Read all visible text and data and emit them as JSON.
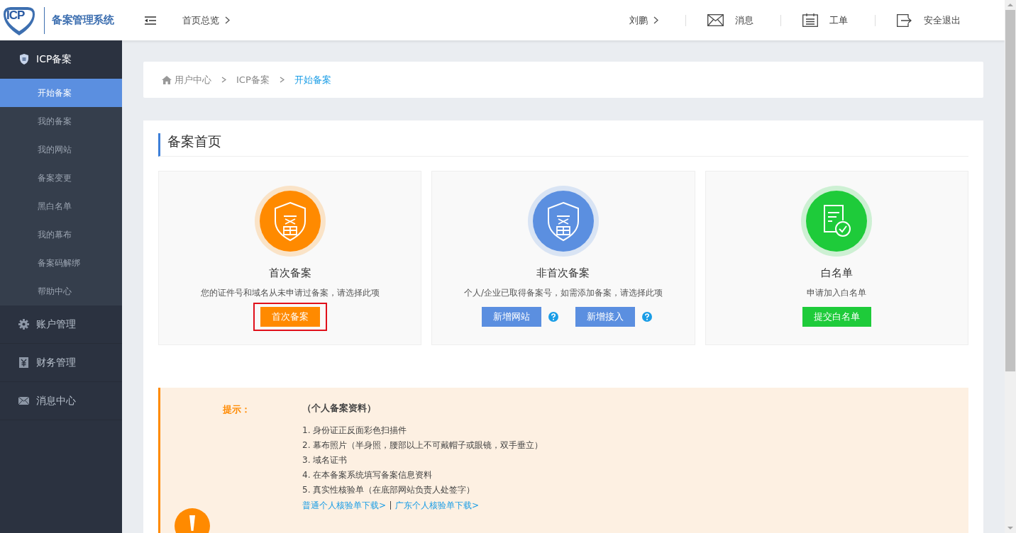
{
  "logo": {
    "mark": "ICP",
    "title": "备案管理系统"
  },
  "topbar": {
    "page": "首页总览",
    "user": "刘鹏",
    "actions": [
      {
        "kind": "mail",
        "label": "消息"
      },
      {
        "kind": "list",
        "label": "工单"
      },
      {
        "kind": "logout",
        "label": "安全退出"
      }
    ]
  },
  "sidebar": {
    "groups": [
      {
        "kind": "shield",
        "label": "ICP备案",
        "expanded": true,
        "children": [
          {
            "label": "开始备案",
            "selected": true
          },
          {
            "label": "我的备案",
            "selected": false
          },
          {
            "label": "我的网站",
            "selected": false
          },
          {
            "label": "备案变更",
            "selected": false
          },
          {
            "label": "黑白名单",
            "selected": false
          },
          {
            "label": "我的幕布",
            "selected": false
          },
          {
            "label": "备案码解绑",
            "selected": false
          },
          {
            "label": "帮助中心",
            "selected": false
          }
        ]
      },
      {
        "kind": "gear",
        "label": "账户管理",
        "expanded": false
      },
      {
        "kind": "yen",
        "label": "财务管理",
        "expanded": false
      },
      {
        "kind": "mail",
        "label": "消息中心",
        "expanded": false
      }
    ]
  },
  "breadcrumb": [
    "用户中心",
    "ICP备案",
    "开始备案"
  ],
  "section_title": "备案首页",
  "options": [
    {
      "kind": "shield",
      "color": "#ff8a00",
      "title": "首次备案",
      "desc": "您的证件号和域名从未申请过备案，请选择此项",
      "buttons": [
        {
          "label": "首次备案",
          "help": false,
          "highlighted": true
        }
      ]
    },
    {
      "kind": "shield",
      "color": "#5b8fe0",
      "title": "非首次备案",
      "desc": "个人/企业已取得备案号，如需添加备案，请选择此项",
      "buttons": [
        {
          "label": "新增网站",
          "help": true,
          "highlighted": false
        },
        {
          "label": "新增接入",
          "help": true,
          "highlighted": false
        }
      ]
    },
    {
      "kind": "document",
      "color": "#1ecb3a",
      "title": "白名单",
      "desc": "申请加入白名单",
      "buttons": [
        {
          "label": "提交白名单",
          "help": false,
          "highlighted": false
        }
      ]
    }
  ],
  "tips": {
    "label": "提示：",
    "heading": "（个人备案资料）",
    "items": [
      "1. 身份证正反面彩色扫描件",
      "2. 幕布照片（半身照，腰部以上不可戴帽子或眼镜，双手垂立）",
      "3. 域名证书",
      "4. 在本备案系统填写备案信息资料",
      "5. 真实性核验单（在底部网站负责人处签字）"
    ],
    "links": [
      "普通个人核验单下载>",
      "广东个人核验单下载>"
    ]
  }
}
